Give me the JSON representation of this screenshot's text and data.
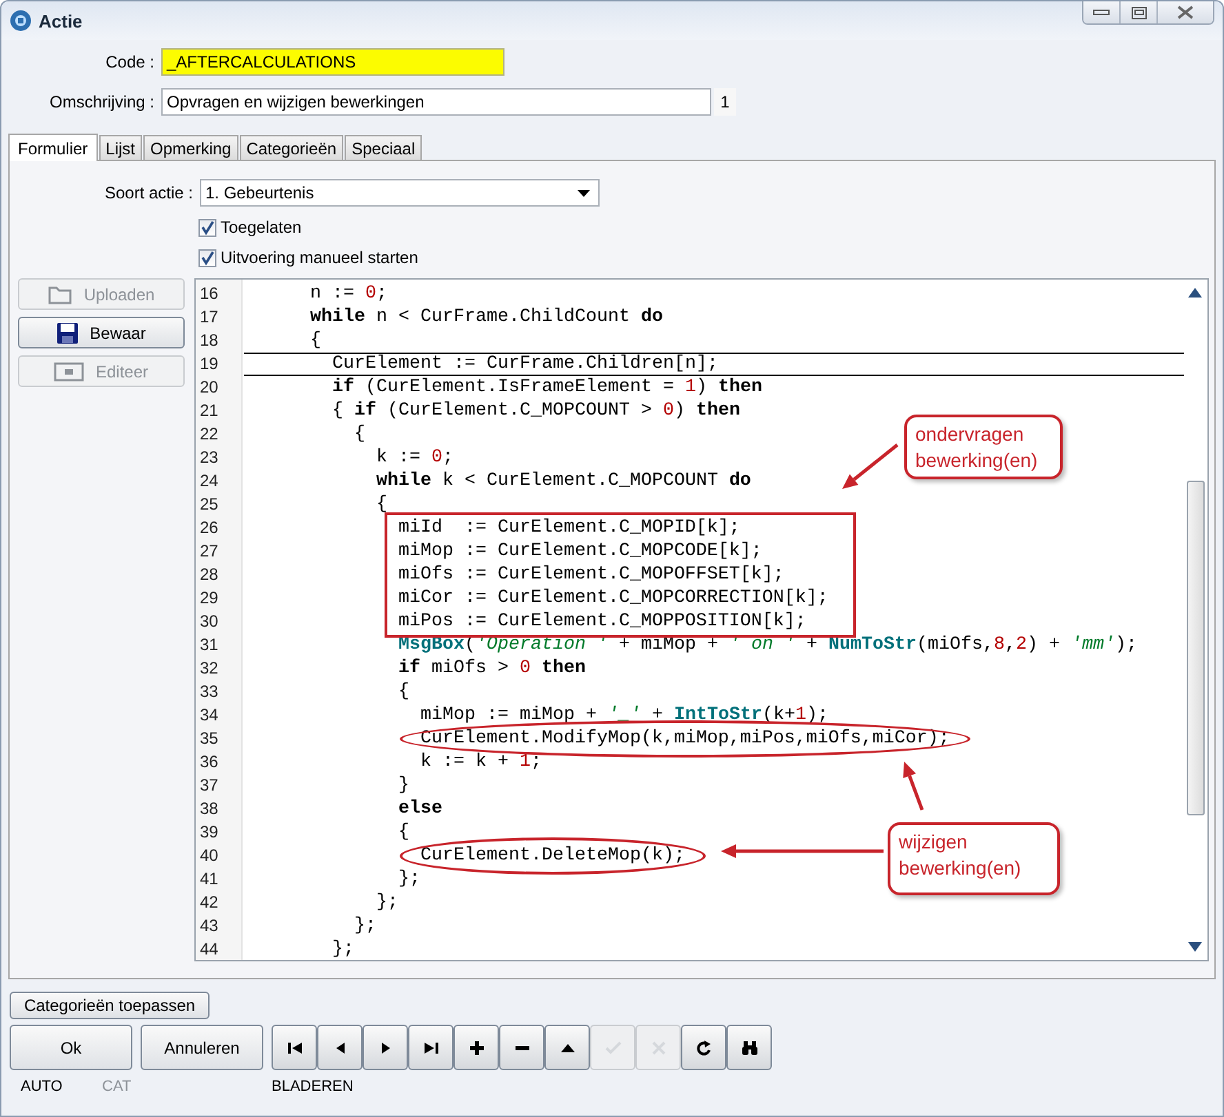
{
  "window": {
    "title": "Actie"
  },
  "form": {
    "code_label": "Code :",
    "code_value": "_AFTERCALCULATIONS",
    "description_label": "Omschrijving :",
    "description_value": "Opvragen en wijzigen bewerkingen",
    "description_counter": "1"
  },
  "tabs": [
    {
      "label": "Formulier",
      "selected": true
    },
    {
      "label": "Lijst",
      "selected": false
    },
    {
      "label": "Opmerking",
      "selected": false
    },
    {
      "label": "Categorieën",
      "selected": false
    },
    {
      "label": "Speciaal",
      "selected": false
    }
  ],
  "action_type": {
    "label": "Soort actie :",
    "value": "1.  Gebeurtenis"
  },
  "checkboxes": [
    {
      "label": "Toegelaten",
      "checked": true
    },
    {
      "label": "Uitvoering manueel starten",
      "checked": true
    }
  ],
  "side_buttons": [
    {
      "kind": "upload",
      "label": "Uploaden",
      "disabled": true
    },
    {
      "kind": "save",
      "label": "Bewaar",
      "disabled": false
    },
    {
      "kind": "edit",
      "label": "Editeer",
      "disabled": true
    }
  ],
  "editor": {
    "lines": [
      {
        "number": "16",
        "current": false,
        "tokens": [
          {
            "kind": "plain",
            "text": "      n := "
          },
          {
            "kind": "number",
            "text": "0"
          },
          {
            "kind": "plain",
            "text": ";"
          }
        ]
      },
      {
        "number": "17",
        "current": false,
        "tokens": [
          {
            "kind": "keyword",
            "text": "      while"
          },
          {
            "kind": "plain",
            "text": " n < CurFrame.ChildCount "
          },
          {
            "kind": "keyword",
            "text": "do"
          }
        ]
      },
      {
        "number": "18",
        "current": false,
        "tokens": [
          {
            "kind": "plain",
            "text": "      {"
          }
        ]
      },
      {
        "number": "19",
        "current": true,
        "tokens": [
          {
            "kind": "plain",
            "text": "        CurElement := CurFrame.Children[n];"
          }
        ]
      },
      {
        "number": "20",
        "current": false,
        "tokens": [
          {
            "kind": "keyword",
            "text": "        if"
          },
          {
            "kind": "plain",
            "text": " (CurElement.IsFrameElement = "
          },
          {
            "kind": "number",
            "text": "1"
          },
          {
            "kind": "plain",
            "text": ") "
          },
          {
            "kind": "keyword",
            "text": "then"
          }
        ]
      },
      {
        "number": "21",
        "current": false,
        "tokens": [
          {
            "kind": "plain",
            "text": "        { "
          },
          {
            "kind": "keyword",
            "text": "if"
          },
          {
            "kind": "plain",
            "text": " (CurElement.C_MOPCOUNT > "
          },
          {
            "kind": "number",
            "text": "0"
          },
          {
            "kind": "plain",
            "text": ") "
          },
          {
            "kind": "keyword",
            "text": "then"
          }
        ]
      },
      {
        "number": "22",
        "current": false,
        "tokens": [
          {
            "kind": "plain",
            "text": "          {"
          }
        ]
      },
      {
        "number": "23",
        "current": false,
        "tokens": [
          {
            "kind": "plain",
            "text": "            k := "
          },
          {
            "kind": "number",
            "text": "0"
          },
          {
            "kind": "plain",
            "text": ";"
          }
        ]
      },
      {
        "number": "24",
        "current": false,
        "tokens": [
          {
            "kind": "keyword",
            "text": "            while"
          },
          {
            "kind": "plain",
            "text": " k < CurElement.C_MOPCOUNT "
          },
          {
            "kind": "keyword",
            "text": "do"
          }
        ]
      },
      {
        "number": "25",
        "current": false,
        "tokens": [
          {
            "kind": "plain",
            "text": "            {"
          }
        ]
      },
      {
        "number": "26",
        "current": false,
        "boxed": true,
        "tokens": [
          {
            "kind": "plain",
            "text": "              miId  := CurElement.C_MOPID[k];"
          }
        ]
      },
      {
        "number": "27",
        "current": false,
        "boxed": true,
        "tokens": [
          {
            "kind": "plain",
            "text": "              miMop := CurElement.C_MOPCODE[k];"
          }
        ]
      },
      {
        "number": "28",
        "current": false,
        "boxed": true,
        "tokens": [
          {
            "kind": "plain",
            "text": "              miOfs := CurElement.C_MOPOFFSET[k];"
          }
        ]
      },
      {
        "number": "29",
        "current": false,
        "boxed": true,
        "tokens": [
          {
            "kind": "plain",
            "text": "              miCor := CurElement.C_MOPCORRECTION[k];"
          }
        ]
      },
      {
        "number": "30",
        "current": false,
        "boxed": true,
        "tokens": [
          {
            "kind": "plain",
            "text": "              miPos := CurElement.C_MOPPOSITION[k];"
          }
        ]
      },
      {
        "number": "31",
        "current": false,
        "tokens": [
          {
            "kind": "function",
            "text": "              MsgBox"
          },
          {
            "kind": "plain",
            "text": "("
          },
          {
            "kind": "string",
            "text": "'Operation '"
          },
          {
            "kind": "plain",
            "text": " + miMop + "
          },
          {
            "kind": "string",
            "text": "' on '"
          },
          {
            "kind": "plain",
            "text": " + "
          },
          {
            "kind": "function",
            "text": "NumToStr"
          },
          {
            "kind": "plain",
            "text": "(miOfs,"
          },
          {
            "kind": "number",
            "text": "8"
          },
          {
            "kind": "plain",
            "text": ","
          },
          {
            "kind": "number",
            "text": "2"
          },
          {
            "kind": "plain",
            "text": ") + "
          },
          {
            "kind": "string",
            "text": "'mm'"
          },
          {
            "kind": "plain",
            "text": ");"
          }
        ]
      },
      {
        "number": "32",
        "current": false,
        "tokens": [
          {
            "kind": "keyword",
            "text": "              if"
          },
          {
            "kind": "plain",
            "text": " miOfs > "
          },
          {
            "kind": "number",
            "text": "0"
          },
          {
            "kind": "keyword",
            "text": " then"
          }
        ]
      },
      {
        "number": "33",
        "current": false,
        "tokens": [
          {
            "kind": "plain",
            "text": "              {"
          }
        ]
      },
      {
        "number": "34",
        "current": false,
        "tokens": [
          {
            "kind": "plain",
            "text": "                miMop := miMop + "
          },
          {
            "kind": "string",
            "text": "'_'"
          },
          {
            "kind": "plain",
            "text": " + "
          },
          {
            "kind": "function",
            "text": "IntToStr"
          },
          {
            "kind": "plain",
            "text": "(k+"
          },
          {
            "kind": "number",
            "text": "1"
          },
          {
            "kind": "plain",
            "text": ");"
          }
        ]
      },
      {
        "number": "35",
        "current": false,
        "circled": true,
        "tokens": [
          {
            "kind": "plain",
            "text": "                CurElement.ModifyMop(k,miMop,miPos,miOfs,miCor);"
          }
        ]
      },
      {
        "number": "36",
        "current": false,
        "tokens": [
          {
            "kind": "plain",
            "text": "                k := k + "
          },
          {
            "kind": "number",
            "text": "1"
          },
          {
            "kind": "plain",
            "text": ";"
          }
        ]
      },
      {
        "number": "37",
        "current": false,
        "tokens": [
          {
            "kind": "plain",
            "text": "              }"
          }
        ]
      },
      {
        "number": "38",
        "current": false,
        "tokens": [
          {
            "kind": "keyword",
            "text": "              else"
          }
        ]
      },
      {
        "number": "39",
        "current": false,
        "tokens": [
          {
            "kind": "plain",
            "text": "              {"
          }
        ]
      },
      {
        "number": "40",
        "current": false,
        "circled": true,
        "tokens": [
          {
            "kind": "plain",
            "text": "                CurElement.DeleteMop(k);"
          }
        ]
      },
      {
        "number": "41",
        "current": false,
        "tokens": [
          {
            "kind": "plain",
            "text": "              };"
          }
        ]
      },
      {
        "number": "42",
        "current": false,
        "tokens": [
          {
            "kind": "plain",
            "text": "            };"
          }
        ]
      },
      {
        "number": "43",
        "current": false,
        "tokens": [
          {
            "kind": "plain",
            "text": "          };"
          }
        ]
      },
      {
        "number": "44",
        "current": false,
        "tokens": [
          {
            "kind": "plain",
            "text": "        };"
          }
        ]
      }
    ],
    "annotations": [
      {
        "text": "ondervragen bewerking(en)"
      },
      {
        "text": "wijzigen bewerking(en)"
      }
    ]
  },
  "apply_categories_button": "Categorieën toepassen",
  "buttons": [
    {
      "label": "Ok"
    },
    {
      "label": "Annuleren"
    }
  ],
  "nav_buttons": [
    {
      "kind": "first",
      "disabled": false
    },
    {
      "kind": "previous",
      "disabled": false
    },
    {
      "kind": "next",
      "disabled": false
    },
    {
      "kind": "last",
      "disabled": false
    },
    {
      "kind": "add",
      "disabled": false
    },
    {
      "kind": "remove",
      "disabled": false
    },
    {
      "kind": "up",
      "disabled": false
    },
    {
      "kind": "confirm",
      "disabled": true
    },
    {
      "kind": "cancel",
      "disabled": true
    },
    {
      "kind": "refresh",
      "disabled": false
    },
    {
      "kind": "search",
      "disabled": false
    }
  ],
  "status_bar": [
    {
      "text": "AUTO",
      "disabled": false
    },
    {
      "text": "CAT",
      "disabled": true
    },
    {
      "text": "BLADEREN",
      "disabled": false
    }
  ]
}
